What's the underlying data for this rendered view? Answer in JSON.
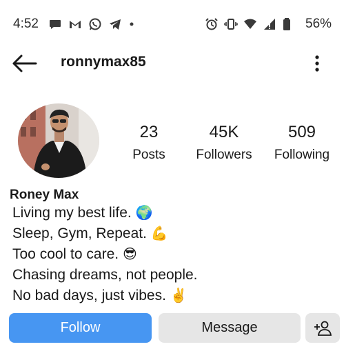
{
  "status_bar": {
    "time": "4:52",
    "battery_percent": "56%",
    "left_icons": [
      "chat-bubble-icon",
      "gmail-icon",
      "whatsapp-icon",
      "telegram-icon",
      "notification-dot-icon"
    ],
    "right_icons": [
      "alarm-icon",
      "vibrate-icon",
      "wifi-icon",
      "cellular-signal-icon",
      "battery-icon"
    ]
  },
  "header": {
    "username": "ronnymax85"
  },
  "profile": {
    "display_name": "Roney Max",
    "stats": {
      "posts": {
        "count": "23",
        "label": "Posts"
      },
      "followers": {
        "count": "45K",
        "label": "Followers"
      },
      "following": {
        "count": "509",
        "label": "Following"
      }
    },
    "bio": [
      {
        "text": "Living my best life.",
        "emoji": "🌍"
      },
      {
        "text": "Sleep, Gym, Repeat.",
        "emoji": "💪"
      },
      {
        "text": "Too cool to care.",
        "emoji": "😎"
      },
      {
        "text": "Chasing dreams, not people.",
        "emoji": ""
      },
      {
        "text": "No bad days, just vibes.",
        "emoji": "✌️"
      }
    ]
  },
  "actions": {
    "follow_label": "Follow",
    "message_label": "Message"
  },
  "colors": {
    "follow_button": "#4796f2",
    "secondary_button": "#e6e6e6",
    "text": "#1a1a1a"
  }
}
